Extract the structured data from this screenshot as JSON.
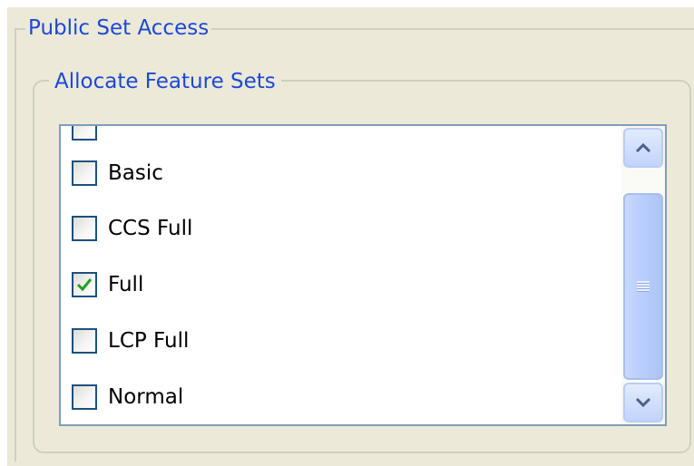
{
  "outer_group": {
    "title": "Public Set Access"
  },
  "inner_group": {
    "title": "Allocate Feature Sets"
  },
  "feature_list": {
    "items": [
      {
        "label": "",
        "checked": false
      },
      {
        "label": "Basic",
        "checked": false
      },
      {
        "label": "CCS Full",
        "checked": false
      },
      {
        "label": "Full",
        "checked": true
      },
      {
        "label": "LCP Full",
        "checked": false
      },
      {
        "label": "Normal",
        "checked": false
      }
    ]
  },
  "scrollbar": {
    "up_icon": "chevron-up-icon",
    "down_icon": "chevron-down-icon",
    "grip_icon": "grip-icon"
  },
  "colors": {
    "legend_text": "#1c48d8",
    "panel_bg": "#ece9d8",
    "list_border": "#7f9db9",
    "check_mark": "#21a121",
    "scroll_accent": "#c2d3fc"
  }
}
